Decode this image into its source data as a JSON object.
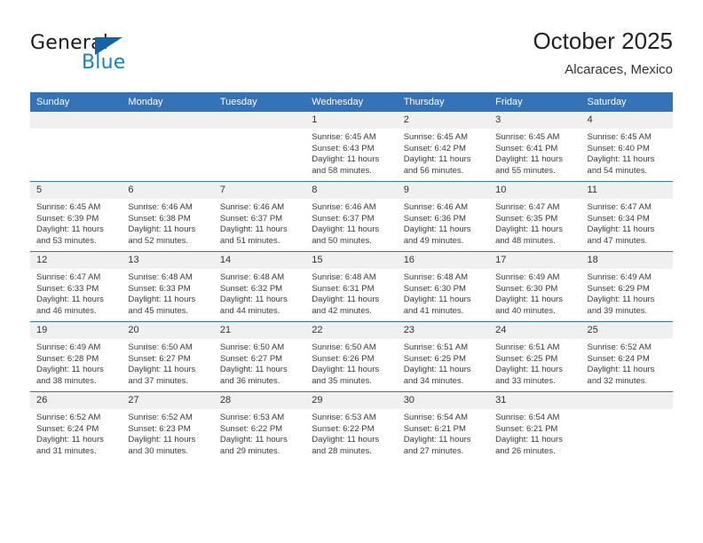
{
  "brand": {
    "name_top": "General",
    "name_bottom": "Blue",
    "flag_color": "#1464a5",
    "blue_color": "#1d7fc3"
  },
  "header": {
    "title": "October 2025",
    "subtitle": "Alcaraces, Mexico"
  },
  "theme": {
    "header_row_bg": "#3573b9",
    "daynum_bg": "#f0f0f0",
    "text_color": "#3a3a3a"
  },
  "weekday_headers": [
    "Sunday",
    "Monday",
    "Tuesday",
    "Wednesday",
    "Thursday",
    "Friday",
    "Saturday"
  ],
  "weeks": [
    [
      {
        "day": "",
        "sunrise": "",
        "sunset": "",
        "daylight": "",
        "empty": true
      },
      {
        "day": "",
        "sunrise": "",
        "sunset": "",
        "daylight": "",
        "empty": true
      },
      {
        "day": "",
        "sunrise": "",
        "sunset": "",
        "daylight": "",
        "empty": true
      },
      {
        "day": "1",
        "sunrise": "Sunrise: 6:45 AM",
        "sunset": "Sunset: 6:43 PM",
        "daylight": "Daylight: 11 hours and 58 minutes."
      },
      {
        "day": "2",
        "sunrise": "Sunrise: 6:45 AM",
        "sunset": "Sunset: 6:42 PM",
        "daylight": "Daylight: 11 hours and 56 minutes."
      },
      {
        "day": "3",
        "sunrise": "Sunrise: 6:45 AM",
        "sunset": "Sunset: 6:41 PM",
        "daylight": "Daylight: 11 hours and 55 minutes."
      },
      {
        "day": "4",
        "sunrise": "Sunrise: 6:45 AM",
        "sunset": "Sunset: 6:40 PM",
        "daylight": "Daylight: 11 hours and 54 minutes."
      }
    ],
    [
      {
        "day": "5",
        "sunrise": "Sunrise: 6:45 AM",
        "sunset": "Sunset: 6:39 PM",
        "daylight": "Daylight: 11 hours and 53 minutes."
      },
      {
        "day": "6",
        "sunrise": "Sunrise: 6:46 AM",
        "sunset": "Sunset: 6:38 PM",
        "daylight": "Daylight: 11 hours and 52 minutes."
      },
      {
        "day": "7",
        "sunrise": "Sunrise: 6:46 AM",
        "sunset": "Sunset: 6:37 PM",
        "daylight": "Daylight: 11 hours and 51 minutes."
      },
      {
        "day": "8",
        "sunrise": "Sunrise: 6:46 AM",
        "sunset": "Sunset: 6:37 PM",
        "daylight": "Daylight: 11 hours and 50 minutes."
      },
      {
        "day": "9",
        "sunrise": "Sunrise: 6:46 AM",
        "sunset": "Sunset: 6:36 PM",
        "daylight": "Daylight: 11 hours and 49 minutes."
      },
      {
        "day": "10",
        "sunrise": "Sunrise: 6:47 AM",
        "sunset": "Sunset: 6:35 PM",
        "daylight": "Daylight: 11 hours and 48 minutes."
      },
      {
        "day": "11",
        "sunrise": "Sunrise: 6:47 AM",
        "sunset": "Sunset: 6:34 PM",
        "daylight": "Daylight: 11 hours and 47 minutes."
      }
    ],
    [
      {
        "day": "12",
        "sunrise": "Sunrise: 6:47 AM",
        "sunset": "Sunset: 6:33 PM",
        "daylight": "Daylight: 11 hours and 46 minutes."
      },
      {
        "day": "13",
        "sunrise": "Sunrise: 6:48 AM",
        "sunset": "Sunset: 6:33 PM",
        "daylight": "Daylight: 11 hours and 45 minutes."
      },
      {
        "day": "14",
        "sunrise": "Sunrise: 6:48 AM",
        "sunset": "Sunset: 6:32 PM",
        "daylight": "Daylight: 11 hours and 44 minutes."
      },
      {
        "day": "15",
        "sunrise": "Sunrise: 6:48 AM",
        "sunset": "Sunset: 6:31 PM",
        "daylight": "Daylight: 11 hours and 42 minutes."
      },
      {
        "day": "16",
        "sunrise": "Sunrise: 6:48 AM",
        "sunset": "Sunset: 6:30 PM",
        "daylight": "Daylight: 11 hours and 41 minutes."
      },
      {
        "day": "17",
        "sunrise": "Sunrise: 6:49 AM",
        "sunset": "Sunset: 6:30 PM",
        "daylight": "Daylight: 11 hours and 40 minutes."
      },
      {
        "day": "18",
        "sunrise": "Sunrise: 6:49 AM",
        "sunset": "Sunset: 6:29 PM",
        "daylight": "Daylight: 11 hours and 39 minutes."
      }
    ],
    [
      {
        "day": "19",
        "sunrise": "Sunrise: 6:49 AM",
        "sunset": "Sunset: 6:28 PM",
        "daylight": "Daylight: 11 hours and 38 minutes."
      },
      {
        "day": "20",
        "sunrise": "Sunrise: 6:50 AM",
        "sunset": "Sunset: 6:27 PM",
        "daylight": "Daylight: 11 hours and 37 minutes."
      },
      {
        "day": "21",
        "sunrise": "Sunrise: 6:50 AM",
        "sunset": "Sunset: 6:27 PM",
        "daylight": "Daylight: 11 hours and 36 minutes."
      },
      {
        "day": "22",
        "sunrise": "Sunrise: 6:50 AM",
        "sunset": "Sunset: 6:26 PM",
        "daylight": "Daylight: 11 hours and 35 minutes."
      },
      {
        "day": "23",
        "sunrise": "Sunrise: 6:51 AM",
        "sunset": "Sunset: 6:25 PM",
        "daylight": "Daylight: 11 hours and 34 minutes."
      },
      {
        "day": "24",
        "sunrise": "Sunrise: 6:51 AM",
        "sunset": "Sunset: 6:25 PM",
        "daylight": "Daylight: 11 hours and 33 minutes."
      },
      {
        "day": "25",
        "sunrise": "Sunrise: 6:52 AM",
        "sunset": "Sunset: 6:24 PM",
        "daylight": "Daylight: 11 hours and 32 minutes."
      }
    ],
    [
      {
        "day": "26",
        "sunrise": "Sunrise: 6:52 AM",
        "sunset": "Sunset: 6:24 PM",
        "daylight": "Daylight: 11 hours and 31 minutes."
      },
      {
        "day": "27",
        "sunrise": "Sunrise: 6:52 AM",
        "sunset": "Sunset: 6:23 PM",
        "daylight": "Daylight: 11 hours and 30 minutes."
      },
      {
        "day": "28",
        "sunrise": "Sunrise: 6:53 AM",
        "sunset": "Sunset: 6:22 PM",
        "daylight": "Daylight: 11 hours and 29 minutes."
      },
      {
        "day": "29",
        "sunrise": "Sunrise: 6:53 AM",
        "sunset": "Sunset: 6:22 PM",
        "daylight": "Daylight: 11 hours and 28 minutes."
      },
      {
        "day": "30",
        "sunrise": "Sunrise: 6:54 AM",
        "sunset": "Sunset: 6:21 PM",
        "daylight": "Daylight: 11 hours and 27 minutes."
      },
      {
        "day": "31",
        "sunrise": "Sunrise: 6:54 AM",
        "sunset": "Sunset: 6:21 PM",
        "daylight": "Daylight: 11 hours and 26 minutes."
      },
      {
        "day": "",
        "sunrise": "",
        "sunset": "",
        "daylight": "",
        "empty": true
      }
    ]
  ]
}
